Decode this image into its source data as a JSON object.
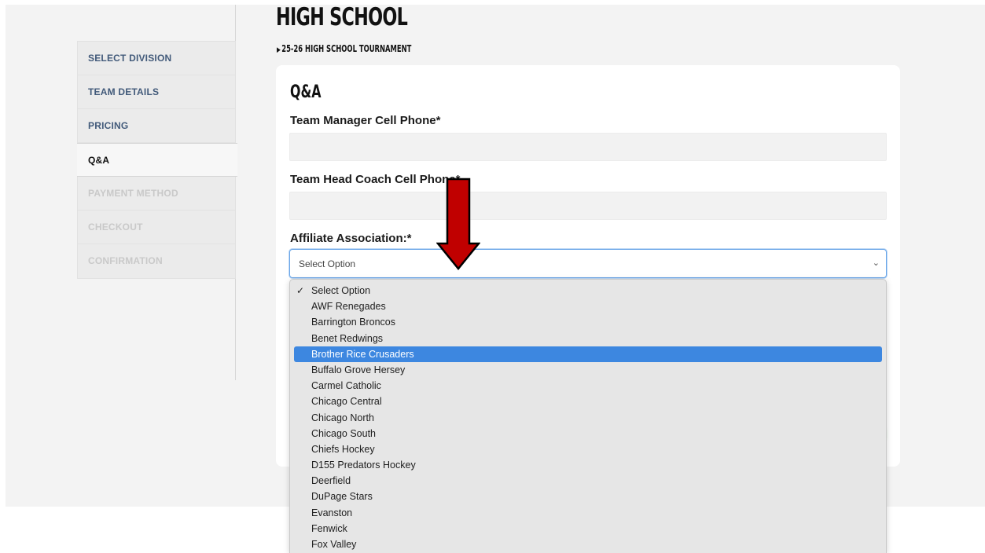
{
  "header": {
    "title": "HIGH SCHOOL",
    "breadcrumb": "25-26 HIGH SCHOOL TOURNAMENT"
  },
  "steps": [
    {
      "label": "SELECT DIVISION",
      "state": "done"
    },
    {
      "label": "TEAM DETAILS",
      "state": "done"
    },
    {
      "label": "PRICING",
      "state": "done"
    },
    {
      "label": "Q&A",
      "state": "active"
    },
    {
      "label": "PAYMENT METHOD",
      "state": "disabled"
    },
    {
      "label": "CHECKOUT",
      "state": "disabled"
    },
    {
      "label": "CONFIRMATION",
      "state": "disabled"
    }
  ],
  "form": {
    "section_title": "Q&A",
    "fields": [
      {
        "label": "Team Manager Cell Phone*",
        "value": ""
      },
      {
        "label": "Team Head Coach Cell Phone*",
        "value": ""
      }
    ],
    "affiliate": {
      "label": "Affiliate Association:*",
      "selected": "Select Option"
    }
  },
  "dropdown": {
    "checked_option": "Select Option",
    "highlighted_option": "Brother Rice Crusaders",
    "options": [
      "Select Option",
      "AWF Renegades",
      "Barrington Broncos",
      "Benet Redwings",
      "Brother Rice Crusaders",
      "Buffalo Grove Hersey",
      "Carmel Catholic",
      "Chicago Central",
      "Chicago North",
      "Chicago South",
      "Chiefs Hockey",
      "D155 Predators Hockey",
      "Deerfield",
      "DuPage Stars",
      "Evanston",
      "Fenwick",
      "Fox Valley"
    ]
  },
  "colors": {
    "annotation_arrow": "#c00000",
    "highlight": "#3d87e0",
    "step_label": "#425a7a"
  },
  "icons": {
    "breadcrumb": "triangle-right-icon",
    "select": "chevron-down-icon",
    "checked": "checkmark-icon",
    "annotation": "red-down-arrow"
  }
}
